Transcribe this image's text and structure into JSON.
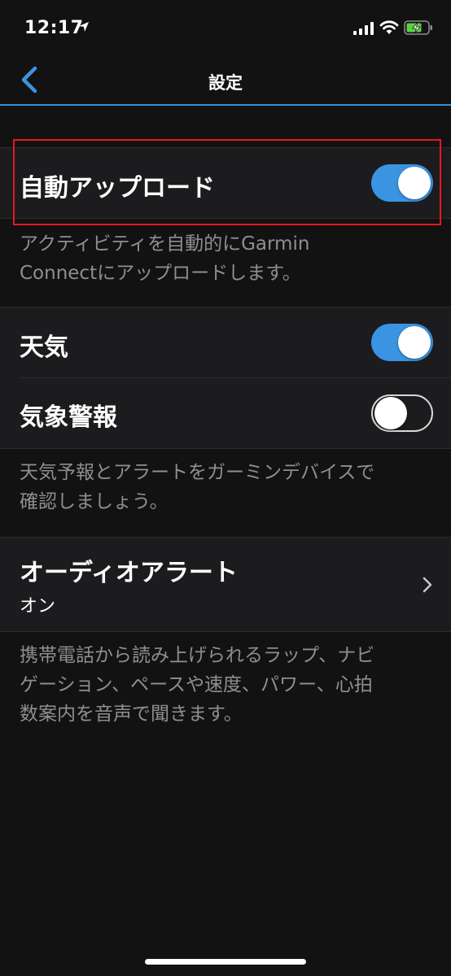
{
  "status_bar": {
    "time": "12:17"
  },
  "nav": {
    "title": "設定"
  },
  "auto_upload": {
    "label": "自動アップロード",
    "enabled": true,
    "description_line1": "アクティビティを自動的にGarmin",
    "description_line2": "Connectにアップロードします。"
  },
  "weather": {
    "label": "天気",
    "enabled": true
  },
  "weather_alerts": {
    "label": "気象警報",
    "enabled": false,
    "description_line1": "天気予報とアラートをガーミンデバイスで",
    "description_line2": "確認しましょう。"
  },
  "audio_alerts": {
    "label": "オーディオアラート",
    "value": "オン",
    "description_line1": "携帯電話から読み上げられるラップ、ナビ",
    "description_line2": "ゲーション、ペースや速度、パワー、心拍",
    "description_line3": "数案内を音声で聞きます。"
  },
  "colors": {
    "background": "#121212",
    "row_background": "#1c1c1e",
    "accent_blue": "#3a94e2",
    "highlight_red": "#e5191f",
    "secondary_text": "#8e8e93"
  },
  "icons": [
    "location-arrow-icon",
    "cellular-signal-icon",
    "wifi-icon",
    "battery-charging-icon",
    "back-chevron-icon",
    "chevron-right-icon"
  ]
}
